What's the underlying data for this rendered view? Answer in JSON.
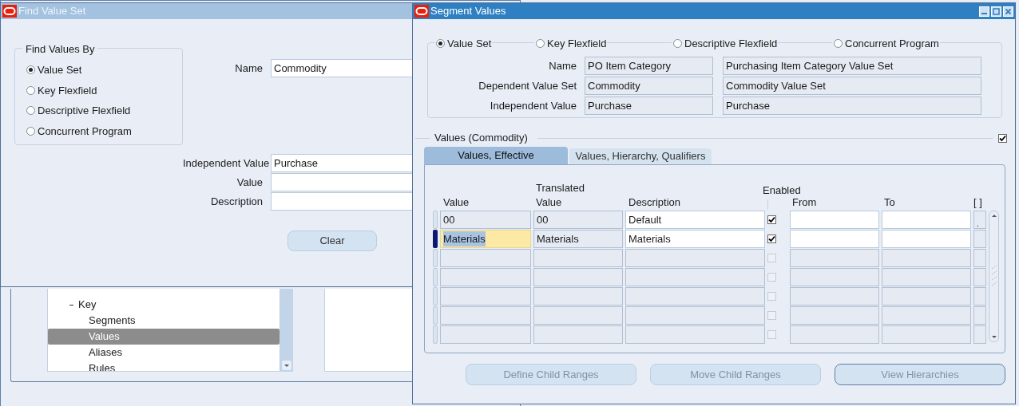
{
  "navigator": {
    "tree": [
      {
        "label": "Key",
        "expanded": true,
        "selected": false,
        "children": [
          {
            "label": "Segments",
            "selected": false
          },
          {
            "label": "Values",
            "selected": true
          },
          {
            "label": "Aliases",
            "selected": false
          },
          {
            "label": "Rules",
            "selected": false
          }
        ]
      }
    ]
  },
  "find_window": {
    "title": "Find Value Set",
    "active": false,
    "group_title": "Find Values By",
    "options": [
      {
        "label": "Value Set",
        "selected": true
      },
      {
        "label": "Key Flexfield",
        "selected": false
      },
      {
        "label": "Descriptive Flexfield",
        "selected": false
      },
      {
        "label": "Concurrent Program",
        "selected": false
      }
    ],
    "fields": [
      {
        "label": "Name",
        "value": "Commodity"
      },
      {
        "label": "Independent Value",
        "value": "Purchase"
      },
      {
        "label": "Value"
      },
      {
        "label": "Description"
      }
    ],
    "buttons": [
      {
        "label": "Clear"
      }
    ]
  },
  "segment_window": {
    "title": "Segment Values",
    "active": true,
    "options": [
      {
        "label": "Value Set",
        "selected": true
      },
      {
        "label": "Key Flexfield",
        "selected": false
      },
      {
        "label": "Descriptive Flexfield",
        "selected": false
      },
      {
        "label": "Concurrent Program",
        "selected": false
      }
    ],
    "fields": [
      {
        "label": "Name",
        "value": "PO Item Category",
        "description": "Purchasing Item Category Value Set"
      },
      {
        "label": "Dependent Value Set",
        "value": "Commodity",
        "description": "Commodity Value Set"
      },
      {
        "label": "Independent Value",
        "value": "Purchase",
        "description": "Purchase"
      }
    ],
    "section": {
      "title": "Values (Commodity)",
      "checked": true
    },
    "tabs": [
      {
        "label": "Values, Effective",
        "selected": true
      },
      {
        "label": "Values, Hierarchy, Qualifiers",
        "selected": false
      }
    ],
    "columns": {
      "value": "Value",
      "translated_value": "Translated Value",
      "description": "Description",
      "enabled": "Enabled",
      "from": "From",
      "to": "To",
      "flag": "[ ]"
    },
    "rows": [
      {
        "value": "00",
        "translated_value": "00",
        "description": "Default",
        "enabled": true,
        "flag": ".",
        "selected": false
      },
      {
        "value": "Materials",
        "translated_value": "Materials",
        "description": "Materials",
        "enabled": true,
        "selected": true
      },
      {
        "enabled": false,
        "selected": false
      },
      {
        "enabled": false,
        "selected": false
      },
      {
        "enabled": false,
        "selected": false
      },
      {
        "enabled": false,
        "selected": false
      },
      {
        "enabled": false,
        "selected": false
      }
    ],
    "buttons": [
      {
        "label": "Define Child Ranges",
        "disabled": true,
        "default": false
      },
      {
        "label": "Move Child Ranges",
        "disabled": true,
        "default": false
      },
      {
        "label": "View Hierarchies",
        "disabled": true,
        "default": true
      }
    ]
  }
}
